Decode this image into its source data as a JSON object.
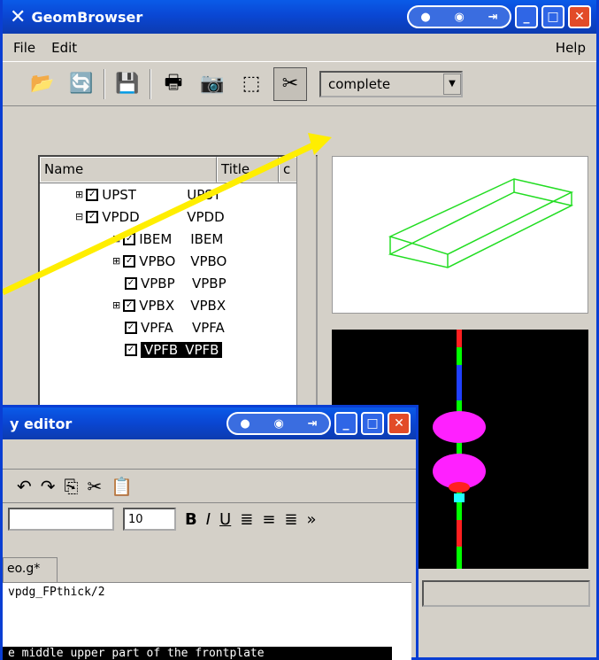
{
  "main_window": {
    "title": "GeomBrowser",
    "menu": {
      "file": "File",
      "edit": "Edit",
      "help": "Help"
    },
    "view_combo": "complete",
    "tree_headers": {
      "name": "Name",
      "title": "Title",
      "c": "c"
    },
    "tree_rows": [
      {
        "name": "UPST",
        "title": "UPST"
      },
      {
        "name": "VPDD",
        "title": "VPDD"
      },
      {
        "name": "IBEM",
        "title": "IBEM"
      },
      {
        "name": "VPBO",
        "title": "VPBO"
      },
      {
        "name": "VPBP",
        "title": "VPBP"
      },
      {
        "name": "VPBX",
        "title": "VPBX"
      },
      {
        "name": "VPFA",
        "title": "VPFA"
      },
      {
        "name": "VPFB",
        "title": "VPFB"
      }
    ]
  },
  "editor_window": {
    "title": "y editor",
    "font_size": "10",
    "tab_label": "eo.g*",
    "line1": "vpdg_FPthick/2",
    "line2": "e middle upper part of the frontplate"
  }
}
